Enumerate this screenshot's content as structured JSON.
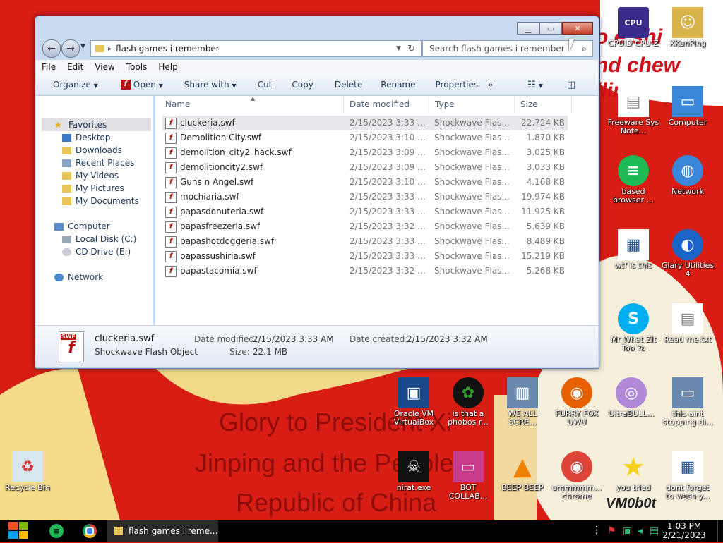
{
  "wallpaper": {
    "top_text_1": "o e shi",
    "top_text_2": "nd chew",
    "top_text_3": "llin",
    "line1": "Glory to President Xi",
    "line2": "Jinping and the People",
    "line3": "Republic of China",
    "signature": "VM0b0t"
  },
  "desktop_icons": [
    {
      "label": "CPUID CPU-Z",
      "icon": "cpuz-icon",
      "color": "#3a2a8a"
    },
    {
      "label": "XKunPing",
      "icon": "user-folder-icon",
      "color": "#d9b44a"
    },
    {
      "label": "Freeware Sys Note...",
      "icon": "document-icon",
      "color": "#ffffff"
    },
    {
      "label": "Computer",
      "icon": "computer-icon",
      "color": "#3a86d8"
    },
    {
      "label": "based browser ...",
      "icon": "chat-icon",
      "color": "#1db954"
    },
    {
      "label": "Network",
      "icon": "network-icon",
      "color": "#3a86d8"
    },
    {
      "label": "wtf is this",
      "icon": "calendar-icon",
      "color": "#ffffff"
    },
    {
      "label": "Glary Utilities 4",
      "icon": "glary-icon",
      "color": "#1a64c8"
    },
    {
      "label": "Mr What Zit Too Ya",
      "icon": "skype-icon",
      "color": "#00aff0"
    },
    {
      "label": "Read me.txt",
      "icon": "text-file-icon",
      "color": "#ffffff"
    },
    {
      "label": "Oracle VM VirtualBox",
      "icon": "virtualbox-icon",
      "color": "#1a4a8a"
    },
    {
      "label": "is that a phobos r...",
      "icon": "icq-icon",
      "color": "#2ca02c"
    },
    {
      "label": "WE ALL SCRE...",
      "icon": "system-icon",
      "color": "#6a8ab0"
    },
    {
      "label": "FURRY FOX UWU",
      "icon": "firefox-icon",
      "color": "#e66000"
    },
    {
      "label": "UltraBULL...",
      "icon": "disc-icon",
      "color": "#b08ad8"
    },
    {
      "label": "this aint stopping di...",
      "icon": "monitor-icon",
      "color": "#6a8ab0"
    },
    {
      "label": "Recycle Bin",
      "icon": "recycle-bin-icon",
      "color": "#d8e6f0"
    },
    {
      "label": "nirat.exe",
      "icon": "skull-icon",
      "color": "#111111"
    },
    {
      "label": "BOT COLLAB...",
      "icon": "tv-icon",
      "color": "#c83a8a"
    },
    {
      "label": "BEEP BEEP",
      "icon": "vlc-icon",
      "color": "#f08000"
    },
    {
      "label": "ummmmm... chrome",
      "icon": "chrome-icon",
      "color": "#db4437"
    },
    {
      "label": "you tried",
      "icon": "star-icon",
      "color": "#f2d21b"
    },
    {
      "label": "dont forget to wash y...",
      "icon": "calendar-icon",
      "color": "#ffffff"
    }
  ],
  "explorer": {
    "address": "flash games i remember",
    "search_placeholder": "Search flash games i remember",
    "menu": [
      "File",
      "Edit",
      "View",
      "Tools",
      "Help"
    ],
    "commands": {
      "organize": "Organize",
      "open": "Open",
      "share": "Share with",
      "cut": "Cut",
      "copy": "Copy",
      "delete": "Delete",
      "rename": "Rename",
      "properties": "Properties",
      "more": "»"
    },
    "nav": {
      "favorites": "Favorites",
      "desktop": "Desktop",
      "downloads": "Downloads",
      "recent": "Recent Places",
      "videos": "My Videos",
      "pictures": "My Pictures",
      "documents": "My Documents",
      "computer": "Computer",
      "local_disk": "Local Disk (C:)",
      "cd_drive": "CD Drive (E:)",
      "network": "Network"
    },
    "columns": {
      "name": "Name",
      "date": "Date modified",
      "type": "Type",
      "size": "Size"
    },
    "files": [
      {
        "name": "cluckeria.swf",
        "date": "2/15/2023 3:33 ...",
        "type": "Shockwave Flas...",
        "size": "22.724 KB"
      },
      {
        "name": "Demolition City.swf",
        "date": "2/15/2023 3:10 ...",
        "type": "Shockwave Flas...",
        "size": "1.870 KB"
      },
      {
        "name": "demolition_city2_hack.swf",
        "date": "2/15/2023 3:09 ...",
        "type": "Shockwave Flas...",
        "size": "3.025 KB"
      },
      {
        "name": "demolitioncity2.swf",
        "date": "2/15/2023 3:09 ...",
        "type": "Shockwave Flas...",
        "size": "3.033 KB"
      },
      {
        "name": "Guns n Angel.swf",
        "date": "2/15/2023 3:10 ...",
        "type": "Shockwave Flas...",
        "size": "4.168 KB"
      },
      {
        "name": "mochiaria.swf",
        "date": "2/15/2023 3:33 ...",
        "type": "Shockwave Flas...",
        "size": "19.974 KB"
      },
      {
        "name": "papasdonuteria.swf",
        "date": "2/15/2023 3:33 ...",
        "type": "Shockwave Flas...",
        "size": "11.925 KB"
      },
      {
        "name": "papasfreezeria.swf",
        "date": "2/15/2023 3:32 ...",
        "type": "Shockwave Flas...",
        "size": "5.639 KB"
      },
      {
        "name": "papashotdoggeria.swf",
        "date": "2/15/2023 3:33 ...",
        "type": "Shockwave Flas...",
        "size": "8.489 KB"
      },
      {
        "name": "papassushiria.swf",
        "date": "2/15/2023 3:33 ...",
        "type": "Shockwave Flas...",
        "size": "15.219 KB"
      },
      {
        "name": "papastacomia.swf",
        "date": "2/15/2023 3:32 ...",
        "type": "Shockwave Flas...",
        "size": "5.268 KB"
      }
    ],
    "details": {
      "icon_label": "SWF",
      "filename": "cluckeria.swf",
      "filetype": "Shockwave Flash Object",
      "modified_label": "Date modified:",
      "modified_value": "2/15/2023 3:33 AM",
      "created_label": "Date created:",
      "created_value": "2/15/2023 3:32 AM",
      "size_label": "Size:",
      "size_value": "22.1 MB"
    }
  },
  "taskbar": {
    "task_label": "flash games i reme...",
    "time": "1:03 PM",
    "date": "2/21/2023"
  },
  "colors": {
    "desktop_red": "#d81e14",
    "selection": "#e8e8ec",
    "flash_red": "#b3120d"
  }
}
